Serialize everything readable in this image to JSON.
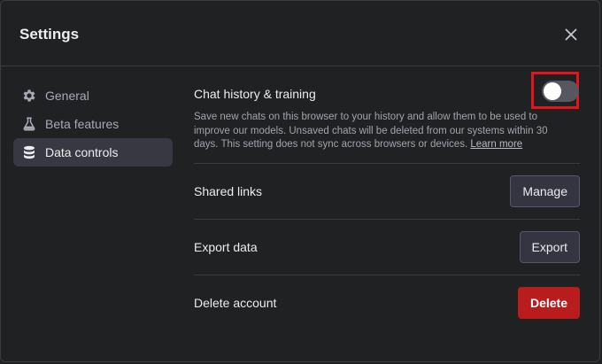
{
  "dialog": {
    "title": "Settings",
    "close_icon": "close-icon"
  },
  "sidebar": {
    "items": [
      {
        "label": "General",
        "icon": "gear-icon",
        "active": false
      },
      {
        "label": "Beta features",
        "icon": "flask-icon",
        "active": false
      },
      {
        "label": "Data controls",
        "icon": "database-icon",
        "active": true
      }
    ]
  },
  "data_controls": {
    "chat_history": {
      "label": "Chat history & training",
      "description": "Save new chats on this browser to your history and allow them to be used to improve our models. Unsaved chats will be deleted from our systems within 30 days. This setting does not sync across browsers or devices.",
      "learn_more": "Learn more",
      "enabled": false
    },
    "shared_links": {
      "label": "Shared links",
      "button": "Manage"
    },
    "export_data": {
      "label": "Export data",
      "button": "Export"
    },
    "delete_account": {
      "label": "Delete account",
      "button": "Delete"
    }
  },
  "colors": {
    "background": "#202123",
    "active_nav": "#373841",
    "danger": "#b91c1c",
    "highlight": "#e3141c"
  }
}
